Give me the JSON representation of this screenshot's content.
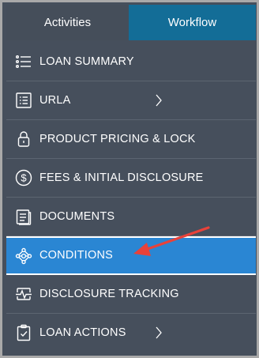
{
  "tabs": [
    {
      "label": "Activities",
      "color": "#454e5a"
    },
    {
      "label": "Workflow",
      "color": "#136d97"
    }
  ],
  "menu": {
    "items": [
      {
        "label": "LOAN SUMMARY",
        "icon": "list-icon",
        "has_submenu": false
      },
      {
        "label": "URLA",
        "icon": "form-icon",
        "has_submenu": true
      },
      {
        "label": "PRODUCT PRICING & LOCK",
        "icon": "lock-icon",
        "has_submenu": false
      },
      {
        "label": "FEES & INITIAL DISCLOSURE",
        "icon": "dollar-circle-icon",
        "has_submenu": false
      },
      {
        "label": "DOCUMENTS",
        "icon": "document-icon",
        "has_submenu": false
      },
      {
        "label": "CONDITIONS",
        "icon": "conditions-network-icon",
        "has_submenu": false,
        "active": true
      },
      {
        "label": "DISCLOSURE TRACKING",
        "icon": "pulse-icon",
        "has_submenu": false
      },
      {
        "label": "LOAN ACTIONS",
        "icon": "clipboard-check-icon",
        "has_submenu": true
      }
    ]
  },
  "colors": {
    "sidebar_bg": "#464f5c",
    "active_bg": "#2a86d3",
    "annotation_arrow": "#e8423a"
  }
}
